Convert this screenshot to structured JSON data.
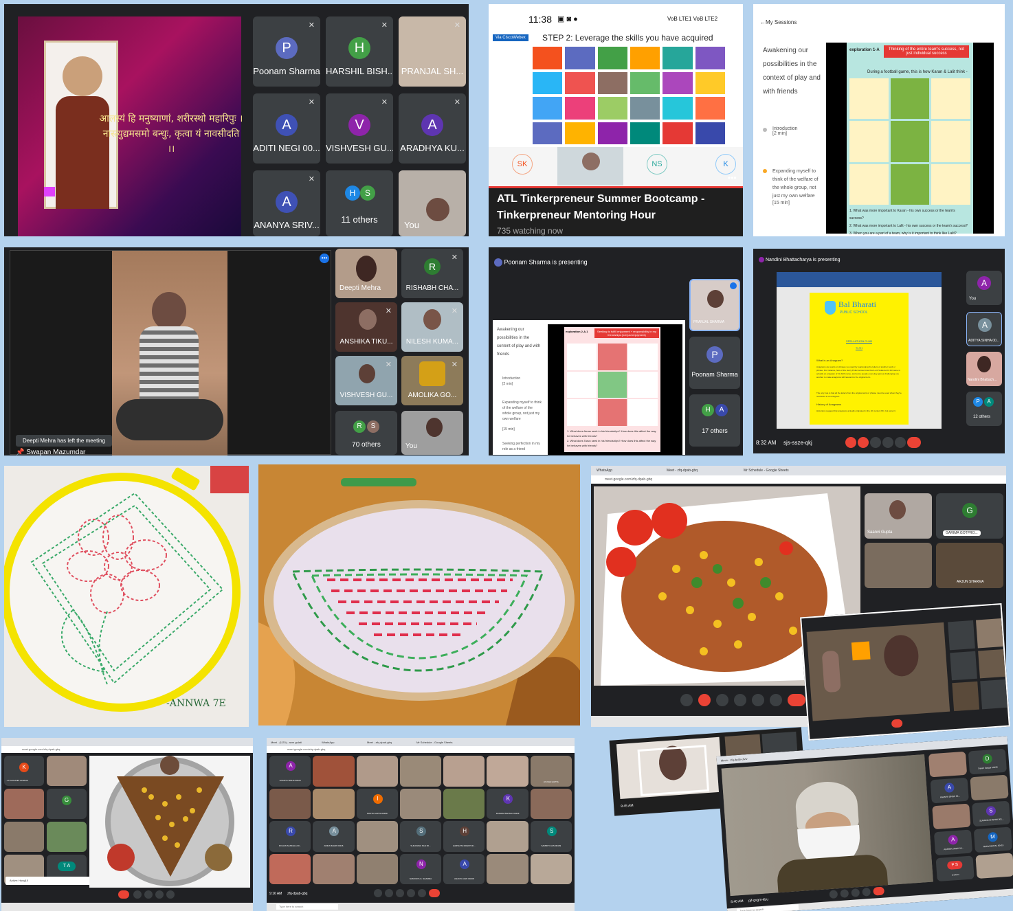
{
  "p1": {
    "shloka_line1": "आलस्यं हि मनुष्याणां, शरीरस्थो महारिपुः ।",
    "shloka_line2": "नास्त्युद्यमसमो बन्धुः, कृत्वा यं नावसीदति ।।",
    "tiles": [
      {
        "initial": "P",
        "name": "Poonam Sharma",
        "color": "#5c6bc0"
      },
      {
        "initial": "H",
        "name": "HARSHIL BISH...",
        "color": "#43a047"
      },
      {
        "initial": "",
        "name": "PRANJAL SH...",
        "color": ""
      },
      {
        "initial": "A",
        "name": "ADITI NEGI 00...",
        "color": "#3f51b5"
      },
      {
        "initial": "V",
        "name": "VISHVESH GU...",
        "color": "#8e24aa"
      },
      {
        "initial": "A",
        "name": "ARADHYA KU...",
        "color": "#5e35b1"
      },
      {
        "initial": "A",
        "name": "ANANYA SRIV...",
        "color": "#3f51b5"
      },
      {
        "initial": "",
        "name": "11 others",
        "color": ""
      },
      {
        "initial": "",
        "name": "You",
        "color": ""
      }
    ],
    "others_avatars": [
      "H",
      "S"
    ]
  },
  "p2": {
    "status_time": "11:38",
    "status_right": "VoB LTE1 VoB LTE2",
    "badge": "Via CiscoWebex",
    "step_title": "STEP 2: Leverage the skills you have acquired",
    "participants": [
      "SK",
      "NS",
      "K"
    ],
    "title_line1": "ATL Tinkerpreneur Summer Bootcamp -",
    "title_line2": "Tinkerpreneur Mentoring Hour",
    "watching": "735 watching now"
  },
  "p3": {
    "back": "My Sessions",
    "heading": "Awakening our possibilities in the context of play and with friends",
    "item1": "Introduction",
    "item1_sub": "[2 min]",
    "item2": "Expanding myself to think of the welfare of the whole group, not just my own welfare",
    "item2_sub": "[15 min]",
    "comic_label": "exploration 1-A",
    "comic_title": "Thinking of the entire team's success, not just individual success",
    "comic_sub": "During a football game, this is how Karan & Lalit think -",
    "q1": "1. What was more important to Karan - his own success or the team's success?",
    "q2": "2. What was more important to Lalit - his own success or the team's success?",
    "q3": "3. When you are a part of a team, why is it important to think like Lalit?"
  },
  "p4": {
    "toast": "Deepti Mehra has left the meeting",
    "presenter": "Swapan Mazumdar",
    "tiles": [
      "Deepti Mehra",
      "RISHABH CHA...",
      "ANSHIKA TIKU...",
      "NILESH KUMA...",
      "VISHVESH GU...",
      "AMOLIKA GO...",
      "70 others",
      "You"
    ],
    "rishabh_initial": "R",
    "others_avatars": [
      "R",
      "S"
    ]
  },
  "p5": {
    "presenting": "Poonam Sharma is presenting",
    "heading": "Awakening our possibilities in the content of play and with friends",
    "item1": "Introduction",
    "item1_sub": "[2 min]",
    "item2": "Expanding myself to think of the welfare of the whole group, not just my own welfare",
    "item2_sub": "[15 min]",
    "item3": "Seeking perfection in my role as a friend",
    "slide_label": "exploration 2-A.1",
    "slide_title": "Seeking to fulfill enjoyment + responsibility in my friendships (not just enjoyment)",
    "q1": "1. What does Aman seek in his friendships? How does this affect the way he behaves with friends?",
    "q2": "2. What does Tarun seek in his friendships? How does this affect the way he behaves with friends?",
    "self_name": "PRANJAL SHARMA",
    "tile_initial": "P",
    "tile_name": "Poonam Sharma",
    "others_avatars": [
      "H",
      "A"
    ],
    "others": "17 others"
  },
  "p6": {
    "presenting": "Nandini Bhattacharya is presenting",
    "school": "Bal Bharati",
    "school_sub": "PUBLIC SCHOOL",
    "doc_line1": "SPELLATHON CLUB",
    "doc_line2": "TI-TH",
    "doc_q": "What is an Anagram?",
    "doc_p1": "Anagrams are words or phrases you spell by rearranging the letters of another word or phrase. For instance, fans of the Harry Potter series know that Lord Voldemort's full name is actually an anagram of his birth name, and some people even play games challenging one another to make anagrams still relevant to the original term.",
    "doc_p2": "The only rule is that all the letters from the original word or phrase must be used when they're reordered to an anagram.",
    "doc_h2": "History of Anagrams",
    "doc_p3": "Historians suggest that anagrams actually originated in the 4th century BC, but weren't.",
    "side": [
      {
        "initial": "A",
        "name": "You"
      },
      {
        "initial": "A",
        "name": "ADITYA SINHA 00..."
      },
      {
        "initial": "",
        "name": "Nandini Bhattach..."
      },
      {
        "initial": "",
        "name": "12 others"
      }
    ],
    "others_avatars": [
      "P",
      "A"
    ],
    "time": "8:32 AM",
    "code": "sjs-ssze-qkj"
  },
  "p7": {
    "signature": "-ANNWA 7E"
  },
  "p9": {
    "tabs": [
      "WhatsApp",
      "Meet - zfq-dpab-gbq",
      "Mr Schedule - Google Sheets"
    ],
    "url": "meet.google.com/zfq-dpab-gbq",
    "names": [
      "Saanvi Gupta",
      "GARIMA GOTPRO...",
      "",
      "ARJUN SHARMA"
    ],
    "g_initial": "G"
  },
  "p10": {
    "tiles": [
      "",
      "",
      "",
      "",
      "",
      "",
      "",
      "",
      "",
      ""
    ]
  },
  "p11": {
    "url": "meet.google.com/zfq-dpab-gbq",
    "left_names": [
      "...eh GAGANPI ALBAHZ",
      "",
      "...o SCHAN CHONPIE",
      "",
      "",
      ""
    ],
    "left_initials": [
      "K",
      "",
      "G",
      "",
      "T A"
    ],
    "toast": "Active: Hung10"
  },
  "p12": {
    "tabs": [
      "Meet - (1/20) - anm gulati",
      "WhatsApp",
      "Meet - zfq-dpab-gbq",
      "Mr Schedule - Google Sheets"
    ],
    "url": "meet.google.com/zfq-dpab-gbq",
    "tiles": [
      {
        "initial": "A",
        "name": "ANANYA SINHA 00429",
        "color": "#8e24aa"
      },
      {
        "initial": "",
        "name": "",
        "color": ""
      },
      {
        "initial": "",
        "name": "",
        "color": ""
      },
      {
        "initial": "",
        "name": "",
        "color": ""
      },
      {
        "initial": "",
        "name": "",
        "color": ""
      },
      {
        "initial": "",
        "name": "",
        "color": ""
      },
      {
        "initial": "",
        "name": "AYUSHI GUPTA",
        "color": ""
      },
      {
        "initial": "",
        "name": "",
        "color": ""
      },
      {
        "initial": "I",
        "name": "SAVITA GUPTA 00458",
        "color": "#ef6c00"
      },
      {
        "initial": "",
        "name": "",
        "color": ""
      },
      {
        "initial": "",
        "name": "",
        "color": ""
      },
      {
        "initial": "K",
        "name": "KESHAV BANSAL 00426",
        "color": "#5e35b1"
      },
      {
        "initial": "R",
        "name": "ROHAN SANKHLA 00...",
        "color": "#3949ab"
      },
      {
        "initial": "A",
        "name": "ANIKA BAHRI 00416",
        "color": "#78909c"
      },
      {
        "initial": "",
        "name": "",
        "color": ""
      },
      {
        "initial": "S",
        "name": "SUHANSHI SAH 00...",
        "color": "#546e7a"
      },
      {
        "initial": "H",
        "name": "HARSHITA RAWAT 00...",
        "color": "#5d4037"
      },
      {
        "initial": "",
        "name": "",
        "color": ""
      },
      {
        "initial": "S",
        "name": "SAMRITI JAIN 00429",
        "color": "#00897b"
      },
      {
        "initial": "",
        "name": "",
        "color": ""
      },
      {
        "initial": "",
        "name": "",
        "color": ""
      },
      {
        "initial": "",
        "name": "",
        "color": ""
      },
      {
        "initial": "N",
        "name": "NAMOSYA G. SHARMA",
        "color": "#8e24aa"
      },
      {
        "initial": "A",
        "name": "ANANYA JAIN 00438",
        "color": "#3949ab"
      }
    ],
    "time": "9:16 AM",
    "code": "zfq-dpab-gbq",
    "taskbar": "Type here to search"
  },
  "p13": {
    "tab": "Mmm - zfq-dpab-ufvw",
    "time": "8:40 AM",
    "code": "pjf-gvgm-kbu",
    "right_initials": [
      "A",
      "D",
      "S",
      "A",
      "M",
      "P S"
    ],
    "right_names": [
      "ANANYA SINGH 00...",
      "Daksh Sangar 00429",
      "SUNAINA SHARMA 001...",
      "AGRIMA SINGH 00...",
      "MANVI GOYAL 00419",
      "3 others"
    ],
    "taskbar": "Type here to search"
  },
  "p14": {
    "time": "8:45 AM",
    "code": "pjf-gvgm-kbu",
    "others": "16 others"
  }
}
